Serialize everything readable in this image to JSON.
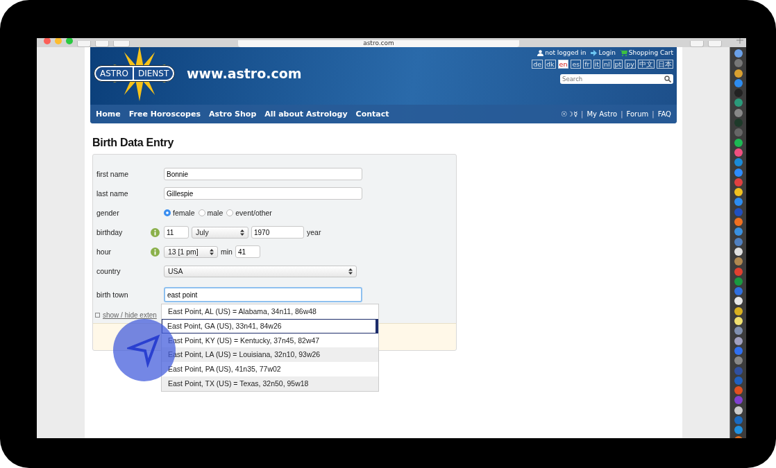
{
  "browser": {
    "address": "astro.com"
  },
  "header": {
    "logo_left": "ASTRO",
    "logo_right": "DIENST",
    "site": "www.astro.com",
    "nav": [
      "Home",
      "Free Horoscopes",
      "Astro Shop",
      "All about Astrology",
      "Contact"
    ],
    "account": [
      {
        "kind": "user",
        "label": "not logged in"
      },
      {
        "kind": "login",
        "label": "Login"
      },
      {
        "kind": "cart",
        "label": "Shopping Cart"
      }
    ],
    "languages": [
      {
        "label": "de",
        "selected": false
      },
      {
        "label": "dk",
        "selected": false
      },
      {
        "label": "en",
        "selected": true
      },
      {
        "label": "es",
        "selected": false
      },
      {
        "label": "fr",
        "selected": false
      },
      {
        "label": "it",
        "selected": false
      },
      {
        "label": "nl",
        "selected": false
      },
      {
        "label": "pt",
        "selected": false
      },
      {
        "label": "py",
        "selected": false
      },
      {
        "label": "中文",
        "selected": false
      },
      {
        "label": "日本",
        "selected": false
      }
    ],
    "search": {
      "placeholder": "Search"
    },
    "symbols": "☉☽☿",
    "separator": "|",
    "links": [
      "My Astro",
      "Forum",
      "FAQ"
    ]
  },
  "form": {
    "title": "Birth Data Entry",
    "first_name": {
      "label": "first name",
      "value": "Bonnie"
    },
    "last_name": {
      "label": "last name",
      "value": "Gillespie"
    },
    "gender": {
      "label": "gender",
      "options": [
        {
          "label": "female",
          "selected": true
        },
        {
          "label": "male",
          "selected": false
        },
        {
          "label": "event/other",
          "selected": false
        }
      ]
    },
    "birthday": {
      "label": "birthday",
      "day": "11",
      "month": "July",
      "year": "1970",
      "year_label": "year"
    },
    "hour": {
      "label": "hour",
      "hour": "13 [1 pm]",
      "min_label": "min",
      "minute": "41"
    },
    "country": {
      "label": "country",
      "value": "USA"
    },
    "birth_town": {
      "label": "birth town",
      "value": "east point"
    },
    "extended_link": "show / hide exten",
    "suggestions": [
      {
        "label": "East Point, AL (US) = Alabama, 34n11, 86w48",
        "selected": false
      },
      {
        "label": "East Point, GA (US), 33n41, 84w26",
        "selected": true
      },
      {
        "label": "East Point, KY (US) = Kentucky, 37n45, 82w47",
        "selected": false
      },
      {
        "label": "East Point, LA (US) = Louisiana, 32n10, 93w26",
        "selected": false
      },
      {
        "label": "East Point, PA (US), 41n35, 77w02",
        "selected": false
      },
      {
        "label": "East Point, TX (US) = Texas, 32n50, 95w18",
        "selected": false
      }
    ]
  }
}
